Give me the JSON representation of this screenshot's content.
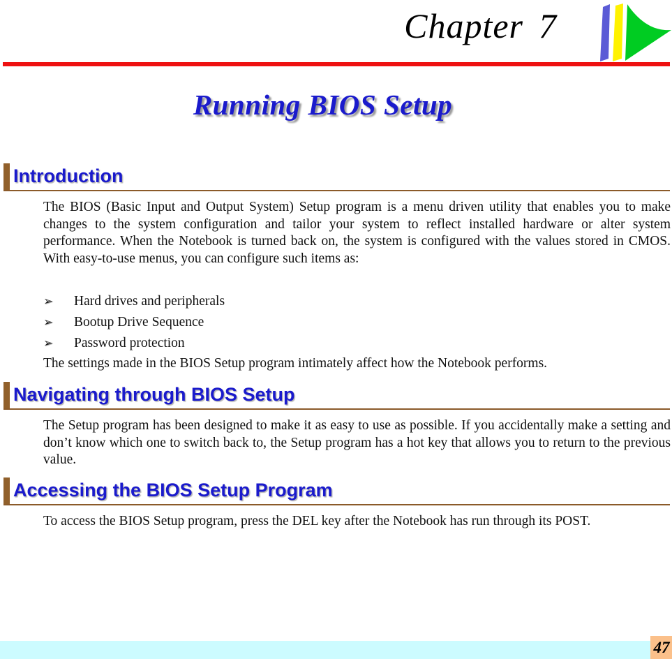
{
  "header": {
    "chapter_word": "Chapter",
    "chapter_number": "7",
    "logo_name": "swoosh-logo",
    "logo_colors": {
      "blue": "#5B5BD6",
      "yellow": "#FFF200",
      "green": "#00CC22"
    },
    "rule_color": "#EE1111"
  },
  "page_title": "Running BIOS Setup",
  "title_color": "#1A1ACC",
  "accent_color": "#91602B",
  "sections": [
    {
      "heading": "Introduction",
      "paragraphs": [
        "The BIOS (Basic Input and Output System) Setup program is a menu driven utility that enables you to make changes to the system configuration and tailor your system to reflect installed hardware or alter system performance.  When the Notebook is turned back on, the system is configured with the values stored in CMOS.  With easy-to-use menus, you can configure such items as:"
      ],
      "bullets": [
        "Hard drives and peripherals",
        "Bootup Drive Sequence",
        "Password protection"
      ],
      "bullet_glyph": "➢",
      "closing": "The settings made in the BIOS Setup program intimately affect how the Notebook performs."
    },
    {
      "heading": "Navigating through BIOS Setup",
      "paragraphs": [
        "The Setup program has been designed to make it as easy to use as possible.  If you accidentally make a setting and don’t know which one to switch back to, the Setup program has a hot key that allows you to return to the previous value."
      ]
    },
    {
      "heading": "Accessing the BIOS Setup Program",
      "paragraphs": [
        "To access the BIOS Setup program, press the DEL key after the Notebook has run through its POST."
      ]
    }
  ],
  "footer": {
    "page_number": "47",
    "band_color": "#CCFBFF",
    "number_box_color": "#FBC08A"
  }
}
